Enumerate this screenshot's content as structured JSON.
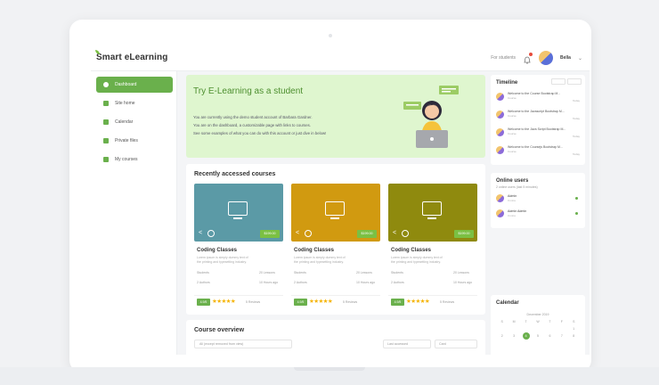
{
  "brand": {
    "name": "Smart eLearning"
  },
  "topbar": {
    "for_students": "For students",
    "user_name": "Bella",
    "chevron": "⌄"
  },
  "sidebar": {
    "items": [
      {
        "label": "Dashboard",
        "icon": "dashboard-icon",
        "active": true
      },
      {
        "label": "Site home",
        "icon": "home-icon",
        "active": false
      },
      {
        "label": "Calendar",
        "icon": "calendar-icon",
        "active": false
      },
      {
        "label": "Private files",
        "icon": "folder-icon",
        "active": false
      },
      {
        "label": "My courses",
        "icon": "graduation-cap-icon",
        "active": false
      }
    ]
  },
  "hero": {
    "title": "Try E-Learning as a student",
    "lines": [
      "You are currently using the demo student account of Barbara Gardner.",
      "You are on the dashboard, a customizable page with links to courses.",
      "See some examples of what you can do with this account or just dive in below!"
    ]
  },
  "recent": {
    "title": "Recently accessed courses",
    "courses": [
      {
        "title": "Coding Classes",
        "price": "$199.00",
        "desc1": "Lorem ipsum is simply dummy text of",
        "desc2": "the printing and typesetting industry.",
        "meta1": "Students",
        "meta2": "20 Lessons",
        "meta3": "2 Authors",
        "meta4": "10 Hours ago",
        "badge": "4.9/5",
        "stars": "★★★★★",
        "reviews": "5 Reviews",
        "color": "#5b9aa6"
      },
      {
        "title": "Coding Classes",
        "price": "$199.00",
        "desc1": "Lorem ipsum is simply dummy text of",
        "desc2": "the printing and typesetting industry.",
        "meta1": "Students",
        "meta2": "20 Lessons",
        "meta3": "2 Authors",
        "meta4": "10 Hours ago",
        "badge": "4.9/5",
        "stars": "★★★★★",
        "reviews": "5 Reviews",
        "color": "#d19a10"
      },
      {
        "title": "Coding Classes",
        "price": "$199.00",
        "desc1": "Lorem ipsum is simply dummy text of",
        "desc2": "the printing and typesetting industry.",
        "meta1": "Students",
        "meta2": "20 Lessons",
        "meta3": "2 Authors",
        "meta4": "10 Hours ago",
        "badge": "4.9/5",
        "stars": "★★★★★",
        "reviews": "5 Reviews",
        "color": "#8f8a0e"
      }
    ]
  },
  "overview": {
    "title": "Course overview",
    "filter": "All (except removed from view)",
    "sort": "Last accessed",
    "view": "Card"
  },
  "timeline": {
    "title": "Timeline",
    "items": [
      {
        "text": "Welcome to the Course Bootstrap M...",
        "sub": "Course",
        "time": "Today"
      },
      {
        "text": "Welcome to the Javascript Bootstrap M...",
        "sub": "Course",
        "time": "Today"
      },
      {
        "text": "Welcome to the Java Script Bootstrap M...",
        "sub": "Course",
        "time": "Today"
      },
      {
        "text": "Welcome to the Coursejs Bootstrap M...",
        "sub": "Course",
        "time": "Today"
      }
    ]
  },
  "online": {
    "title": "Online users",
    "subtitle": "2 online users (last 5 minutes)",
    "users": [
      {
        "name": "Admin",
        "age": "3 mins"
      },
      {
        "name": "Admin Admin",
        "age": "3 mins"
      }
    ]
  },
  "calendar": {
    "title": "Calendar",
    "month": "December 2019",
    "weekdays": [
      "S",
      "M",
      "T",
      "W",
      "T",
      "F",
      "S"
    ],
    "row1": [
      "",
      "",
      "",
      "",
      "",
      "",
      "1"
    ],
    "row2": [
      "2",
      "3",
      "4",
      "5",
      "6",
      "7",
      "8"
    ],
    "today": "4"
  }
}
